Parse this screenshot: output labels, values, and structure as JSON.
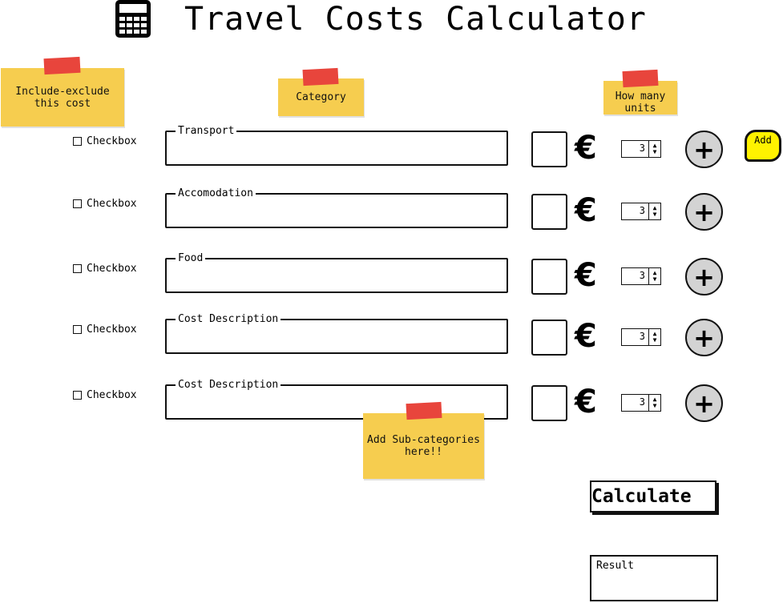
{
  "header": {
    "title": "Travel Costs Calculator",
    "icon": "calculator-icon"
  },
  "notes": {
    "include_exclude": "Include-exclude this cost",
    "category": "Category",
    "how_many_units": "How many units",
    "add_subcategories": "Add Sub-categories here!!"
  },
  "rows": [
    {
      "checkbox_label": "Checkbox",
      "category_label": "Transport",
      "currency": "€",
      "units": "3"
    },
    {
      "checkbox_label": "Checkbox",
      "category_label": "Accomodation",
      "currency": "€",
      "units": "3"
    },
    {
      "checkbox_label": "Checkbox",
      "category_label": "Food",
      "currency": "€",
      "units": "3"
    },
    {
      "checkbox_label": "Checkbox",
      "category_label": "Cost Description",
      "currency": "€",
      "units": "3"
    },
    {
      "checkbox_label": "Checkbox",
      "category_label": "Cost Description",
      "currency": "€",
      "units": "3"
    }
  ],
  "add_bubble": {
    "label": "Add"
  },
  "calculate": {
    "label": "Calculate"
  },
  "result": {
    "label": "Result"
  },
  "colors": {
    "note": "#f6cd4f",
    "tape": "#e8453c",
    "add_bubble": "#fff200",
    "plus_button": "#d3d3d3"
  }
}
